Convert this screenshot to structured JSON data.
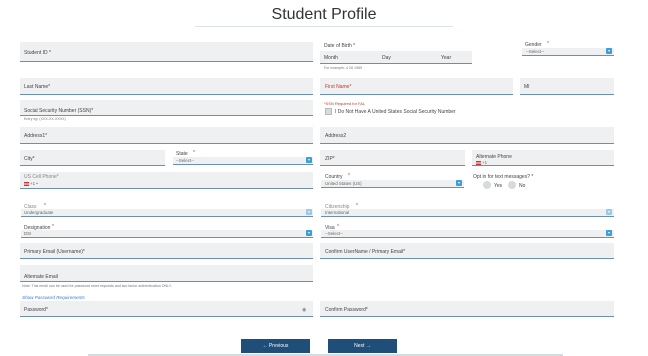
{
  "page_title": "Student Profile",
  "fields": {
    "student_id": "Student ID *",
    "dob": {
      "label": "Date of Birth *",
      "month": "Month",
      "day": "Day",
      "year": "Year",
      "example": "For example: 4 28 1989"
    },
    "gender": {
      "label": "Gender",
      "required": "*",
      "value": "--Select--"
    },
    "last_name": "Last Name*",
    "first_name": "First Name*",
    "mi": "MI",
    "ssn": {
      "label": "Social Security Number (SSN)*",
      "format": "Entry eg: (XXX-XX-XXXX)"
    },
    "ssn_note": "*SSN Required for FAL",
    "no_ssn": "I Do Not Have A United States Social Security Number",
    "address1": "Address1*",
    "address2": "Address2",
    "city": "City*",
    "state": {
      "label": "State",
      "required": "*",
      "value": "--Select--"
    },
    "zip": "ZIP*",
    "alternate_phone": {
      "label": "Alternate Phone",
      "value": "+1"
    },
    "us_cell_phone": {
      "label": "US Cell Phone*",
      "value": "+1 •"
    },
    "country": {
      "label": "Country",
      "required": "*",
      "value": "United States (US)"
    },
    "opt_in": {
      "label": "Opt in for text messages? *",
      "yes": "Yes",
      "no": "No"
    },
    "class": {
      "label": "Class",
      "required": "*",
      "value": "Undergraduate"
    },
    "citizenship": {
      "label": "Citizenship",
      "required": "*",
      "value": "International"
    },
    "designation": {
      "label": "Designation",
      "required": "*",
      "value": "DSI"
    },
    "visa": {
      "label": "Visa",
      "required": "*",
      "value": "--Select--"
    },
    "primary_email": "Primary Email (Username)*",
    "confirm_email": "Confirm UserName / Primary Email*",
    "alternate_email": "Alternate Email",
    "alt_email_note": "Note: This email can be used for password reset requests and two factor authentication ONLY.",
    "show_password": "Show Password Requirements",
    "password": "Password*",
    "confirm_password": "Confirm Password*"
  },
  "buttons": {
    "previous": "← Previous",
    "next": "Next →"
  },
  "colors": {
    "accent": "#3a9fd8",
    "button": "#1f4e79",
    "required_note": "#c0392b"
  }
}
